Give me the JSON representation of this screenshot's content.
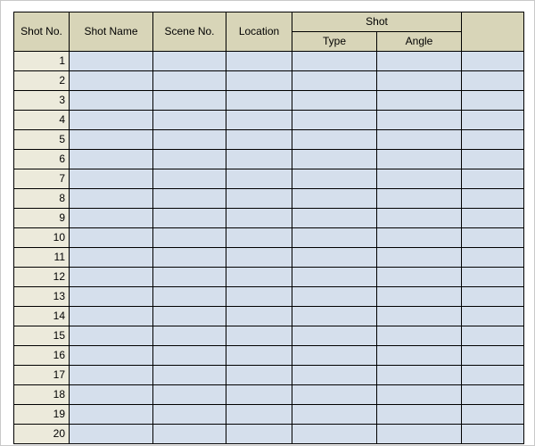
{
  "headers": {
    "shot_no": "Shot No.",
    "shot_name": "Shot Name",
    "scene_no": "Scene No.",
    "location": "Location",
    "shot_group": "Shot",
    "shot_type": "Type",
    "shot_angle": "Angle",
    "extra": ""
  },
  "rows": [
    {
      "no": "1",
      "name": "",
      "scene": "",
      "location": "",
      "type": "",
      "angle": "",
      "extra": ""
    },
    {
      "no": "2",
      "name": "",
      "scene": "",
      "location": "",
      "type": "",
      "angle": "",
      "extra": ""
    },
    {
      "no": "3",
      "name": "",
      "scene": "",
      "location": "",
      "type": "",
      "angle": "",
      "extra": ""
    },
    {
      "no": "4",
      "name": "",
      "scene": "",
      "location": "",
      "type": "",
      "angle": "",
      "extra": ""
    },
    {
      "no": "5",
      "name": "",
      "scene": "",
      "location": "",
      "type": "",
      "angle": "",
      "extra": ""
    },
    {
      "no": "6",
      "name": "",
      "scene": "",
      "location": "",
      "type": "",
      "angle": "",
      "extra": ""
    },
    {
      "no": "7",
      "name": "",
      "scene": "",
      "location": "",
      "type": "",
      "angle": "",
      "extra": ""
    },
    {
      "no": "8",
      "name": "",
      "scene": "",
      "location": "",
      "type": "",
      "angle": "",
      "extra": ""
    },
    {
      "no": "9",
      "name": "",
      "scene": "",
      "location": "",
      "type": "",
      "angle": "",
      "extra": ""
    },
    {
      "no": "10",
      "name": "",
      "scene": "",
      "location": "",
      "type": "",
      "angle": "",
      "extra": ""
    },
    {
      "no": "11",
      "name": "",
      "scene": "",
      "location": "",
      "type": "",
      "angle": "",
      "extra": ""
    },
    {
      "no": "12",
      "name": "",
      "scene": "",
      "location": "",
      "type": "",
      "angle": "",
      "extra": ""
    },
    {
      "no": "13",
      "name": "",
      "scene": "",
      "location": "",
      "type": "",
      "angle": "",
      "extra": ""
    },
    {
      "no": "14",
      "name": "",
      "scene": "",
      "location": "",
      "type": "",
      "angle": "",
      "extra": ""
    },
    {
      "no": "15",
      "name": "",
      "scene": "",
      "location": "",
      "type": "",
      "angle": "",
      "extra": ""
    },
    {
      "no": "16",
      "name": "",
      "scene": "",
      "location": "",
      "type": "",
      "angle": "",
      "extra": ""
    },
    {
      "no": "17",
      "name": "",
      "scene": "",
      "location": "",
      "type": "",
      "angle": "",
      "extra": ""
    },
    {
      "no": "18",
      "name": "",
      "scene": "",
      "location": "",
      "type": "",
      "angle": "",
      "extra": ""
    },
    {
      "no": "19",
      "name": "",
      "scene": "",
      "location": "",
      "type": "",
      "angle": "",
      "extra": ""
    },
    {
      "no": "20",
      "name": "",
      "scene": "",
      "location": "",
      "type": "",
      "angle": "",
      "extra": ""
    }
  ]
}
